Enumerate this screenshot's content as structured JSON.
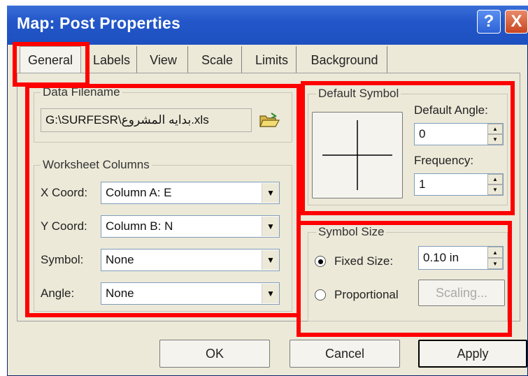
{
  "window": {
    "title": "Map: Post Properties",
    "help_label": "?",
    "close_label": "X"
  },
  "tabs": [
    {
      "label": "General",
      "active": true
    },
    {
      "label": "Labels"
    },
    {
      "label": "View"
    },
    {
      "label": "Scale"
    },
    {
      "label": "Limits"
    },
    {
      "label": "Background"
    }
  ],
  "data_file": {
    "group_label": "Data Filename",
    "value": "G:\\SURFESR\\بدايه المشروع.xls",
    "open_icon": "folder-open-icon"
  },
  "worksheet": {
    "group_label": "Worksheet Columns",
    "rows": [
      {
        "label": "X Coord:",
        "value": "Column A:  E"
      },
      {
        "label": "Y Coord:",
        "value": "Column B:  N"
      },
      {
        "label": "Symbol:",
        "value": "None"
      },
      {
        "label": "Angle:",
        "value": "None"
      }
    ]
  },
  "default_symbol": {
    "group_label": "Default Symbol",
    "angle_label": "Default Angle:",
    "angle_value": "0",
    "frequency_label": "Frequency:",
    "frequency_value": "1"
  },
  "symbol_size": {
    "group_label": "Symbol Size",
    "fixed_label": "Fixed Size:",
    "fixed_value": "0.10 in",
    "fixed_selected": true,
    "proportional_label": "Proportional",
    "scaling_label": "Scaling..."
  },
  "buttons": {
    "ok": "OK",
    "cancel": "Cancel",
    "apply": "Apply"
  },
  "colors": {
    "title_bar": "#2357c9",
    "highlight": "#ff0000",
    "dialog_bg": "#ece9d8"
  }
}
